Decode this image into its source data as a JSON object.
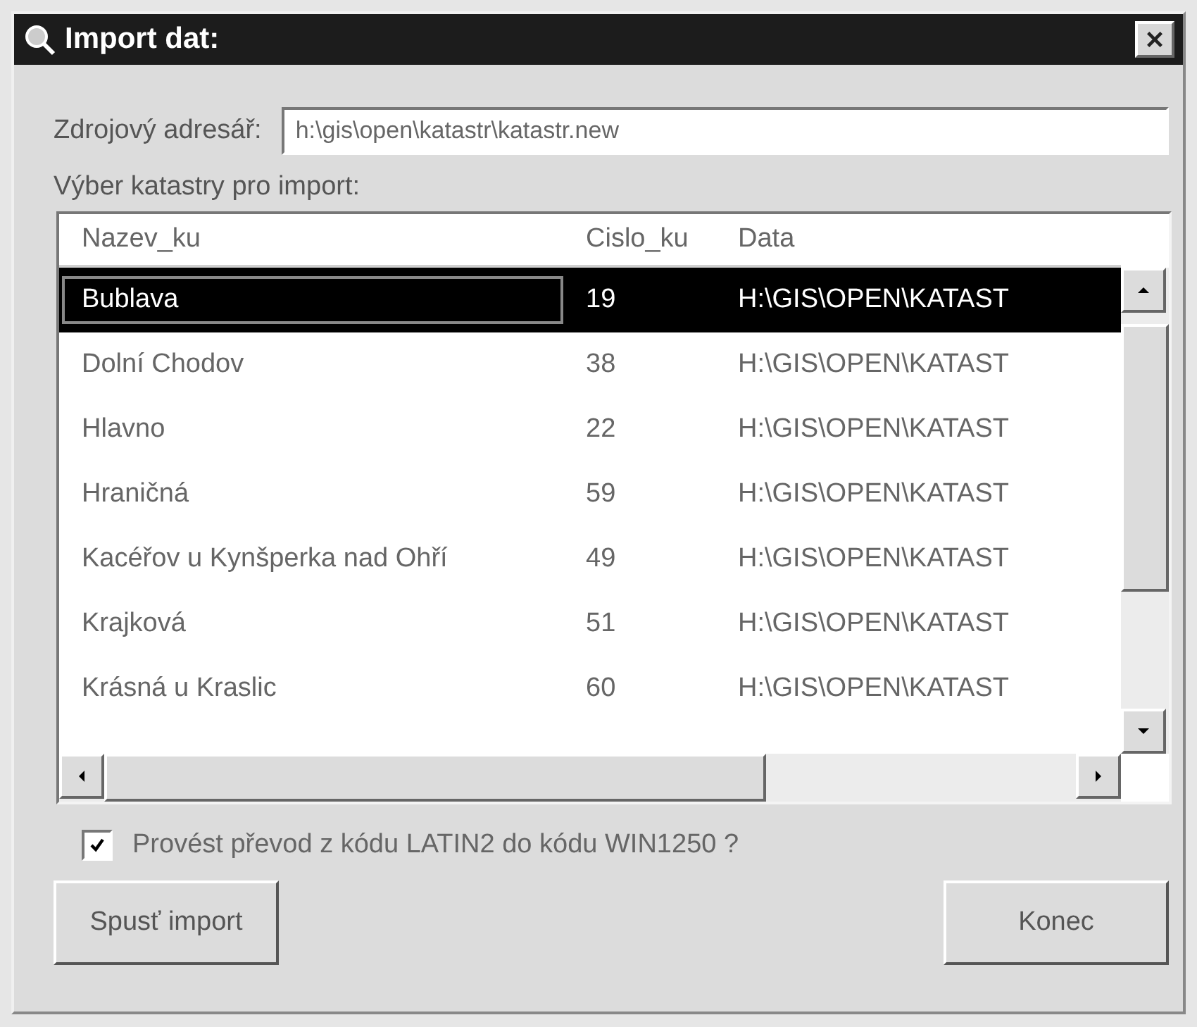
{
  "window": {
    "title": "Import dat:"
  },
  "source": {
    "label": "Zdrojový adresář:",
    "value": "h:\\gis\\open\\katastr\\katastr.new"
  },
  "list_label": "Výber katastry pro import:",
  "table": {
    "columns": [
      "Nazev_ku",
      "Cislo_ku",
      "Data"
    ],
    "rows": [
      {
        "cells": [
          "Bublava",
          "19",
          "H:\\GIS\\OPEN\\KATAST"
        ],
        "selected": true
      },
      {
        "cells": [
          "Dolní Chodov",
          "38",
          "H:\\GIS\\OPEN\\KATAST"
        ],
        "selected": false
      },
      {
        "cells": [
          "Hlavno",
          "22",
          "H:\\GIS\\OPEN\\KATAST"
        ],
        "selected": false
      },
      {
        "cells": [
          "Hraničná",
          "59",
          "H:\\GIS\\OPEN\\KATAST"
        ],
        "selected": false
      },
      {
        "cells": [
          "Kacéřov u Kynšperka nad Ohří",
          "49",
          "H:\\GIS\\OPEN\\KATAST"
        ],
        "selected": false
      },
      {
        "cells": [
          "Krajková",
          "51",
          "H:\\GIS\\OPEN\\KATAST"
        ],
        "selected": false
      },
      {
        "cells": [
          "Krásná u Kraslic",
          "60",
          "H:\\GIS\\OPEN\\KATAST"
        ],
        "selected": false
      }
    ]
  },
  "convert": {
    "label": "Provést převod z kódu LATIN2 do kódu WIN1250 ?",
    "checked": true
  },
  "buttons": [
    "Spusť import",
    "Konec"
  ]
}
